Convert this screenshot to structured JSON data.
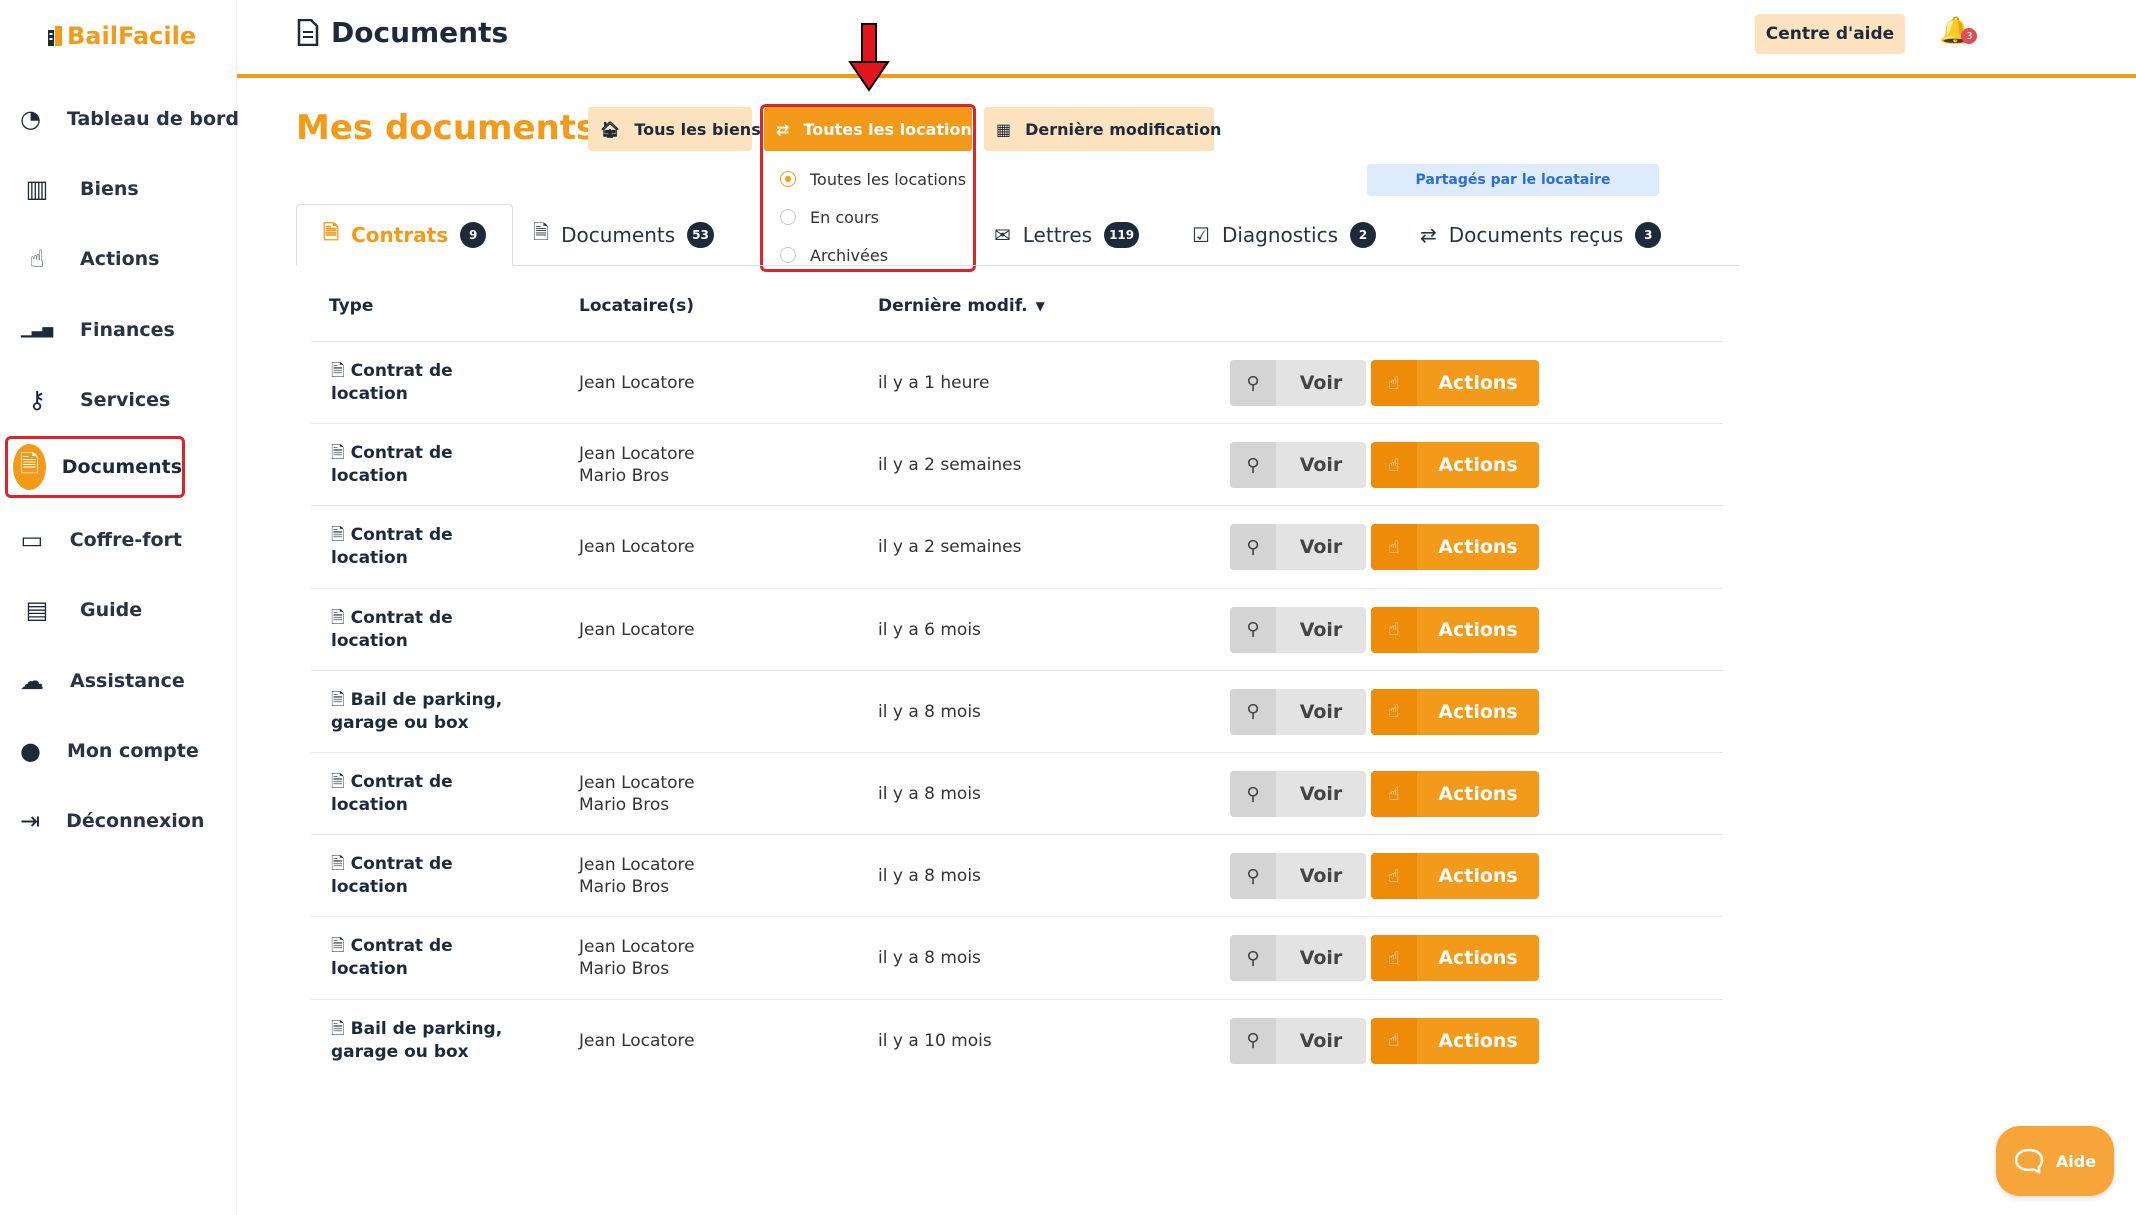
{
  "brand": {
    "name_part1": "Bail",
    "name_part2": "Facile"
  },
  "sidebar": {
    "items": [
      {
        "label": "Tableau de bord",
        "icon": "dashboard-icon"
      },
      {
        "label": "Biens",
        "icon": "building-icon"
      },
      {
        "label": "Actions",
        "icon": "hand-pointer-icon"
      },
      {
        "label": "Finances",
        "icon": "bar-chart-icon"
      },
      {
        "label": "Services",
        "icon": "key-icon"
      },
      {
        "label": "Documents",
        "icon": "file-icon",
        "active": true
      },
      {
        "label": "Coffre-fort",
        "icon": "archive-icon"
      },
      {
        "label": "Guide",
        "icon": "book-icon"
      },
      {
        "label": "Assistance",
        "icon": "chat-icon"
      },
      {
        "label": "Mon compte",
        "icon": "user-icon"
      },
      {
        "label": "Déconnexion",
        "icon": "logout-icon"
      }
    ]
  },
  "header": {
    "title": "Documents",
    "help_center": "Centre d'aide",
    "notifications_count": "3"
  },
  "main": {
    "title": "Mes documents",
    "filters": {
      "properties": "Tous les biens",
      "rentals": "Toutes les locations",
      "sort": "Dernière modification"
    },
    "rental_options": [
      {
        "label": "Toutes les locations",
        "selected": true
      },
      {
        "label": "En cours",
        "selected": false
      },
      {
        "label": "Archivées",
        "selected": false
      }
    ],
    "shared_badge": "Partagés par le locataire"
  },
  "tabs": [
    {
      "label": "Contrats",
      "count": "9",
      "active": true
    },
    {
      "label": "Documents",
      "count": "53"
    },
    {
      "label": "Lettres",
      "count": "119"
    },
    {
      "label": "Diagnostics",
      "count": "2"
    },
    {
      "label": "Documents reçus",
      "count": "3"
    }
  ],
  "table": {
    "headers": {
      "type": "Type",
      "tenants": "Locataire(s)",
      "modified": "Dernière modif."
    },
    "view_label": "Voir",
    "actions_label": "Actions",
    "rows": [
      {
        "type": "Contrat de location",
        "tenants": [
          "Jean Locatore"
        ],
        "modified": "il y a 1 heure"
      },
      {
        "type": "Contrat de location",
        "tenants": [
          "Jean Locatore",
          "Mario Bros"
        ],
        "modified": "il y a 2 semaines"
      },
      {
        "type": "Contrat de location",
        "tenants": [
          "Jean Locatore"
        ],
        "modified": "il y a 2 semaines"
      },
      {
        "type": "Contrat de location",
        "tenants": [
          "Jean Locatore"
        ],
        "modified": "il y a 6 mois"
      },
      {
        "type": "Bail de parking, garage ou box",
        "tenants": [],
        "modified": "il y a 8 mois"
      },
      {
        "type": "Contrat de location",
        "tenants": [
          "Jean Locatore",
          "Mario Bros"
        ],
        "modified": "il y a 8 mois"
      },
      {
        "type": "Contrat de location",
        "tenants": [
          "Jean Locatore",
          "Mario Bros"
        ],
        "modified": "il y a 8 mois"
      },
      {
        "type": "Contrat de location",
        "tenants": [
          "Jean Locatore",
          "Mario Bros"
        ],
        "modified": "il y a 8 mois"
      },
      {
        "type": "Bail de parking, garage ou box",
        "tenants": [
          "Jean Locatore"
        ],
        "modified": "il y a 10 mois"
      }
    ]
  },
  "help_widget": {
    "label": "Aide"
  },
  "colors": {
    "accent": "#f39a1a",
    "highlight": "#d9262d",
    "dark": "#1e2a3a"
  }
}
